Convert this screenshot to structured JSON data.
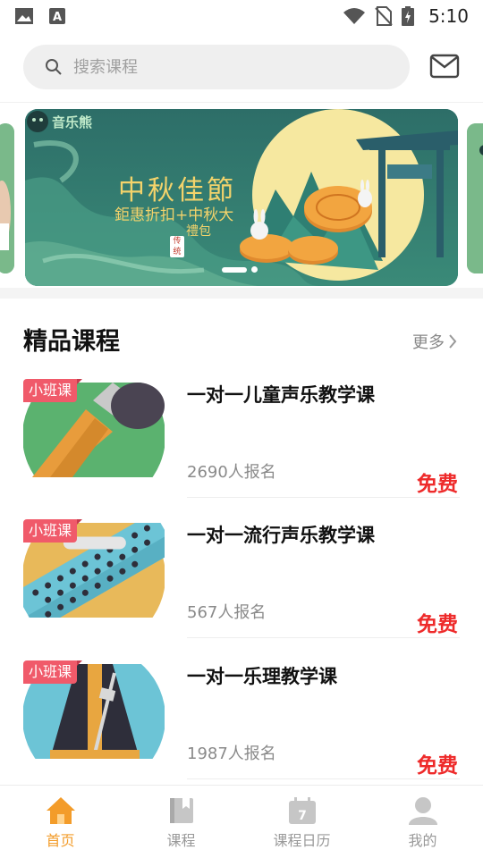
{
  "status_bar": {
    "time": "5:10",
    "icons": [
      "image-icon",
      "text-a-icon",
      "wifi-icon",
      "no-sim-icon",
      "battery-charging-icon"
    ]
  },
  "search": {
    "placeholder": "搜索课程",
    "icons": [
      "search-icon",
      "mail-icon"
    ]
  },
  "banner": {
    "brand": "音乐熊",
    "title": "中秋佳節",
    "subtitle": "鉅惠折扣+中秋大",
    "subtitle2": "禮包",
    "stamp": "传统",
    "page_count": 2,
    "active_page": 1,
    "colors": {
      "background": "#2f7a6f",
      "accent": "#f3d36b"
    }
  },
  "section": {
    "title": "精品课程",
    "more_label": "更多"
  },
  "courses": [
    {
      "tag": "小班课",
      "title": "一对一儿童声乐教学课",
      "count": "2690人报名",
      "price": "免费",
      "image": "microphone-icon"
    },
    {
      "tag": "小班课",
      "title": "一对一流行声乐教学课",
      "count": "567人报名",
      "price": "免费",
      "image": "harmonica-icon"
    },
    {
      "tag": "小班课",
      "title": "一对一乐理教学课",
      "count": "1987人报名",
      "price": "免费",
      "image": "metronome-icon"
    }
  ],
  "bottom_nav": [
    {
      "label": "首页",
      "icon": "home-icon",
      "active": true
    },
    {
      "label": "课程",
      "icon": "book-icon",
      "active": false
    },
    {
      "label": "课程日历",
      "icon": "calendar-icon",
      "active": false,
      "icon_text": "7"
    },
    {
      "label": "我的",
      "icon": "user-icon",
      "active": false
    }
  ],
  "colors": {
    "accent": "#f39c2a",
    "price": "#ee2a2a",
    "tag": "#f05a6a"
  }
}
